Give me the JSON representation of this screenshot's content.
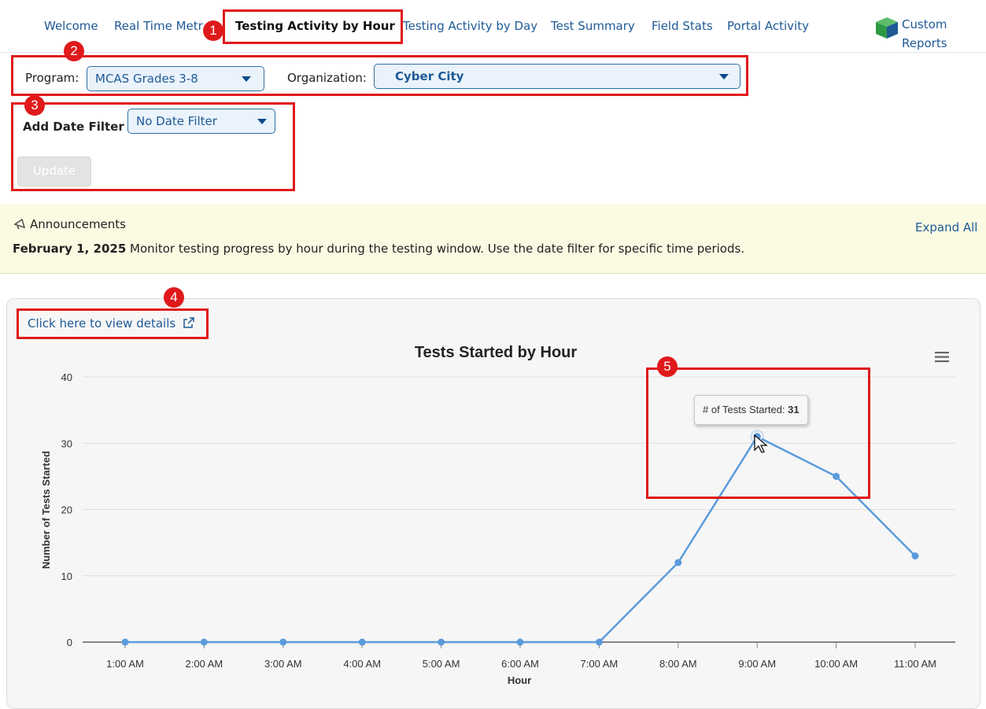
{
  "nav": {
    "items": [
      {
        "label": "Welcome"
      },
      {
        "label": "Real Time Metr"
      },
      {
        "label": "Testing Activity by Hour"
      },
      {
        "label": "Testing Activity by Day"
      },
      {
        "label": "Test Summary"
      },
      {
        "label": "Field Stats"
      },
      {
        "label": "Portal Activity"
      }
    ],
    "active_index": 2,
    "custom_reports_line1": "Custom",
    "custom_reports_line2": "Reports",
    "custom_reports_icon": "cube-icon"
  },
  "filters": {
    "program_label": "Program:",
    "program_value": "MCAS Grades 3-8",
    "organization_label": "Organization:",
    "organization_value": "Cyber City",
    "date_filter_label": "Add Date Filter",
    "date_filter_value": "No Date Filter",
    "update_label": "Update"
  },
  "announcements": {
    "icon": "megaphone-icon",
    "title": "Announcements",
    "expand_label": "Expand All",
    "items": [
      {
        "date": "February 1, 2025",
        "text": "Monitor testing progress by hour during the testing window. Use the date filter for specific time periods."
      }
    ]
  },
  "details_link": "Click here to view details",
  "badges": [
    "1",
    "2",
    "3",
    "4",
    "5"
  ],
  "tooltip": {
    "label": "# of Tests Started:",
    "value": "31"
  },
  "colors": {
    "accent": "#1f5a96",
    "highlight": "#e0191b",
    "series": "#5b9bdc"
  },
  "chart_data": {
    "type": "line",
    "title": "Tests Started by Hour",
    "xlabel": "Hour",
    "ylabel": "Number of Tests Started",
    "categories": [
      "1:00 AM",
      "2:00 AM",
      "3:00 AM",
      "4:00 AM",
      "5:00 AM",
      "6:00 AM",
      "7:00 AM",
      "8:00 AM",
      "9:00 AM",
      "10:00 AM",
      "11:00 AM"
    ],
    "series": [
      {
        "values": [
          0,
          0,
          0,
          0,
          0,
          0,
          0,
          12,
          31,
          25,
          13
        ]
      }
    ],
    "ylim": [
      0,
      40
    ],
    "yticks": [
      "0",
      "10",
      "20",
      "30",
      "40"
    ],
    "grid": true,
    "hovered_index": 8
  }
}
